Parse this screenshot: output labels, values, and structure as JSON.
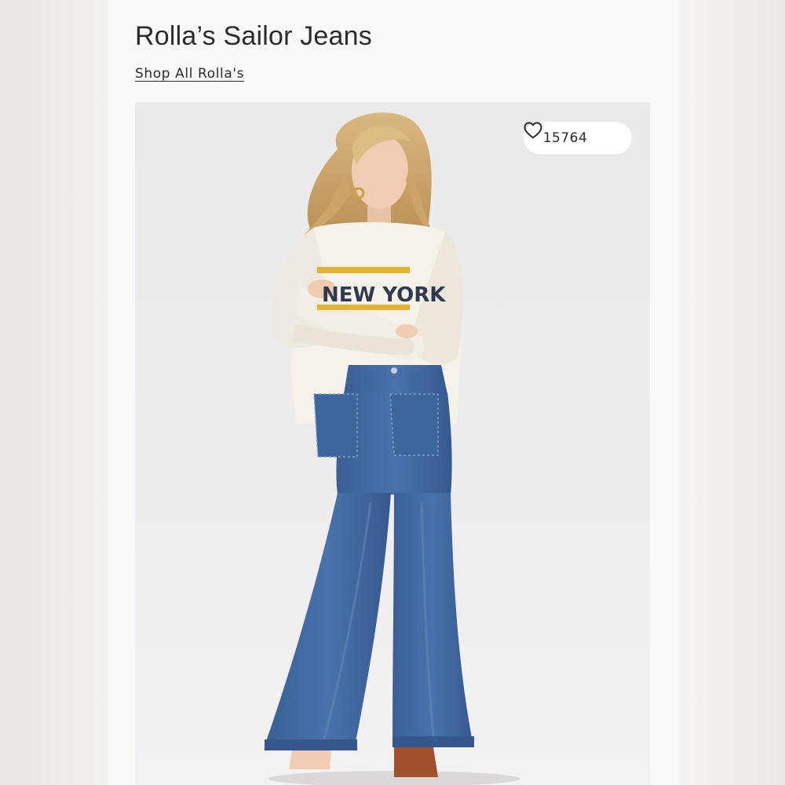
{
  "product": {
    "title": "Rolla’s Sailor Jeans",
    "shop_all_link": "Shop All Rolla's"
  },
  "image": {
    "favorites_count": "15764",
    "favorite_icon": "heart-outline-icon",
    "sweatshirt_print": "NEW YORK"
  },
  "colors": {
    "text": "#2b2b2b",
    "card_background": "#fbf9f8",
    "denim": "#3f679f"
  }
}
